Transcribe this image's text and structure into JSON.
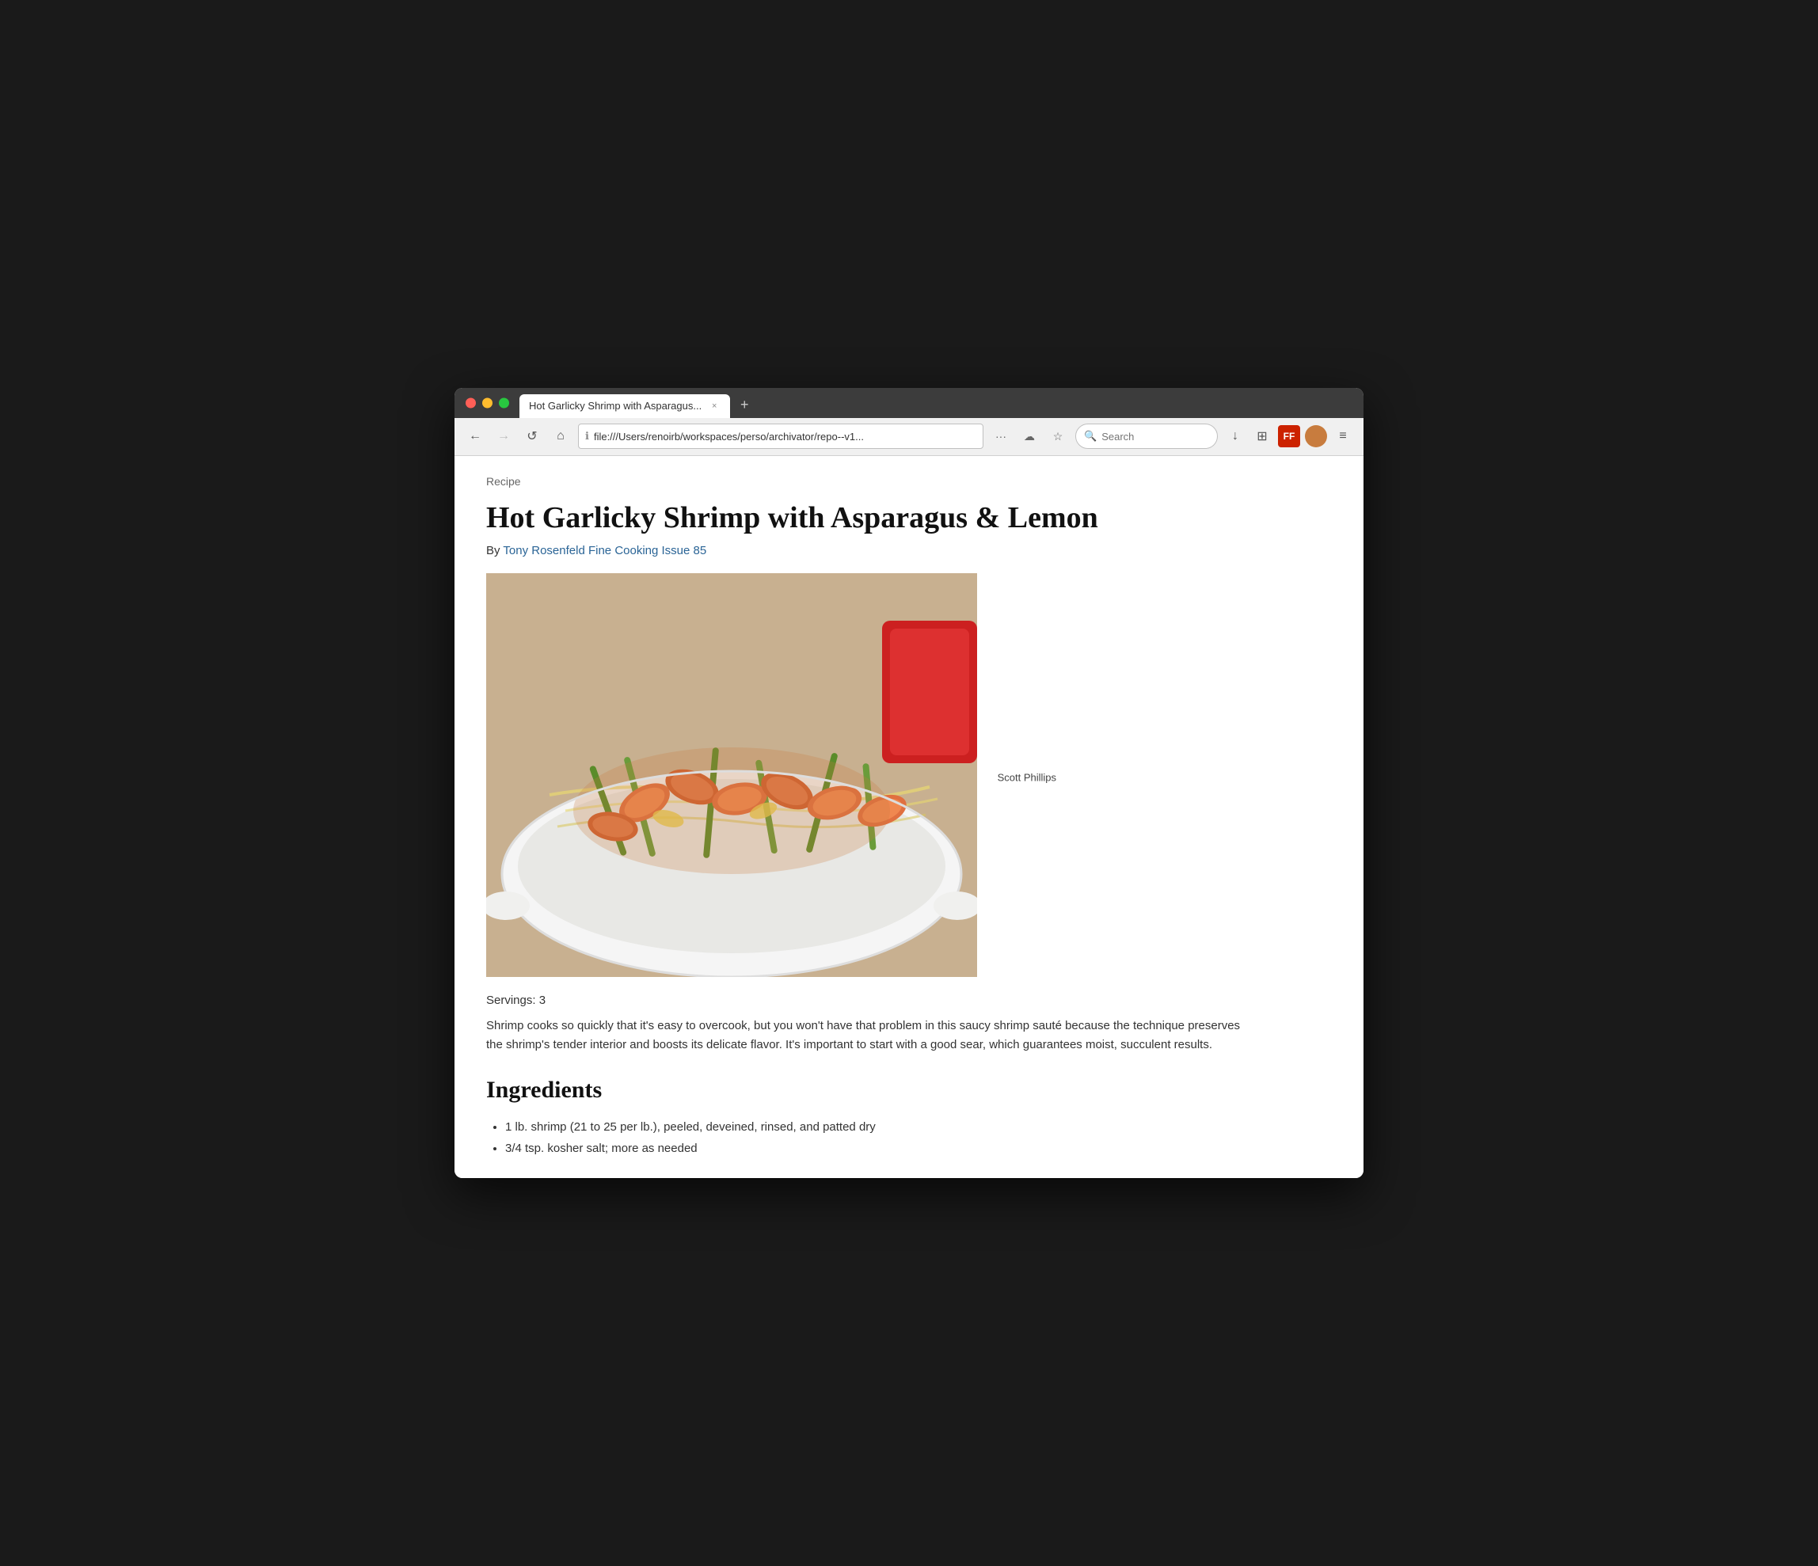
{
  "browser": {
    "tab_title": "Hot Garlicky Shrimp with Asparagus...",
    "tab_close": "×",
    "new_tab": "+",
    "address": "file:///Users/renoirb/workspaces/perso/archivator/repo--v1...",
    "search_placeholder": "Search",
    "traffic_lights": [
      "close",
      "minimize",
      "maximize"
    ]
  },
  "nav": {
    "back": "←",
    "forward": "→",
    "reload": "↺",
    "home": "⌂",
    "more": "···",
    "pocket": "☁",
    "bookmark": "☆",
    "download": "↓",
    "extensions": "⊞",
    "firefox_menu": "≡"
  },
  "page": {
    "breadcrumb": "Recipe",
    "title": "Hot Garlicky Shrimp with Asparagus & Lemon",
    "author_prefix": "By ",
    "author_link_text": "Tony Rosenfeld Fine Cooking Issue 85",
    "image_caption": "Scott Phillips",
    "servings": "Servings: 3",
    "description": "Shrimp cooks so quickly that it's easy to overcook, but you won't have that problem in this saucy shrimp sauté because the technique preserves the shrimp's tender interior and boosts its delicate flavor. It's important to start with a good sear, which guarantees moist, succulent results.",
    "ingredients_title": "Ingredients",
    "ingredients": [
      "1 lb. shrimp (21 to 25 per lb.), peeled, deveined, rinsed, and patted dry",
      "3/4 tsp. kosher salt; more as needed"
    ]
  }
}
